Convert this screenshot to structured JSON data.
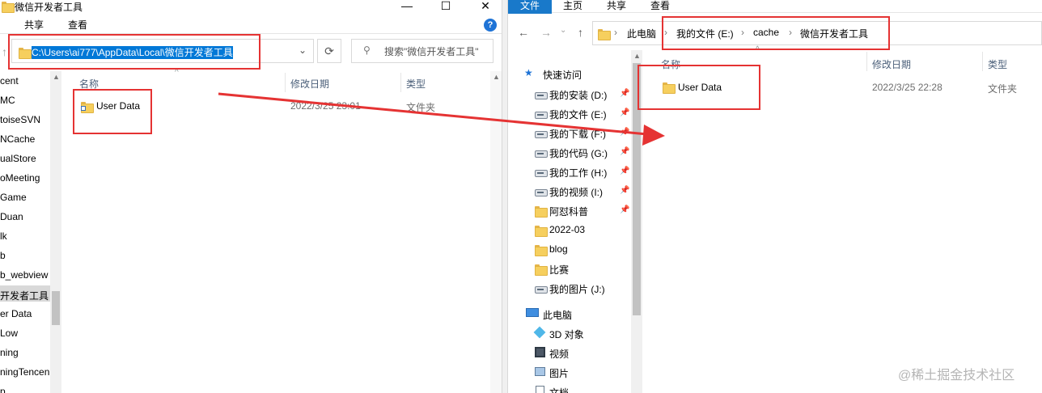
{
  "left_window": {
    "title": "微信开发者工具",
    "caption_min": "—",
    "caption_max": "☐",
    "caption_close": "✕",
    "ribbon_tabs": [
      "共享",
      "查看"
    ],
    "help": "?",
    "address_path": "C:\\Users\\ai777\\AppData\\Local\\微信开发者工具",
    "search_placeholder": "搜索\"微信开发者工具\"",
    "columns": {
      "name": "名称",
      "date": "修改日期",
      "type": "类型"
    },
    "file": {
      "name": "User Data",
      "date": "2022/3/25 23:01",
      "type": "文件夹"
    },
    "sidebar_items": [
      "cent",
      "MC",
      "toiseSVN",
      "NCache",
      "ualStore",
      "oMeeting",
      "Game",
      "Duan",
      "lk",
      "b",
      "b_webview",
      "开发者工具",
      "er Data",
      "Low",
      "ning",
      "ningTencen",
      "p"
    ]
  },
  "right_window": {
    "ribbon_tabs": [
      "文件",
      "主页",
      "共享",
      "查看"
    ],
    "breadcrumb": [
      "此电脑",
      "我的文件 (E:)",
      "cache",
      "微信开发者工具"
    ],
    "columns": {
      "name": "名称",
      "date": "修改日期",
      "type": "类型"
    },
    "file": {
      "name": "User Data",
      "date": "2022/3/25 22:28",
      "type": "文件夹"
    },
    "quick_access": "快速访问",
    "nav_items": [
      {
        "label": "我的安装 (D:)",
        "icon": "drive-icon",
        "pinned": true
      },
      {
        "label": "我的文件 (E:)",
        "icon": "drive-icon",
        "pinned": true
      },
      {
        "label": "我的下载 (F:)",
        "icon": "drive-icon",
        "pinned": true
      },
      {
        "label": "我的代码 (G:)",
        "icon": "drive-icon",
        "pinned": true
      },
      {
        "label": "我的工作 (H:)",
        "icon": "drive-icon",
        "pinned": true
      },
      {
        "label": "我的视频 (I:)",
        "icon": "drive-icon",
        "pinned": true
      },
      {
        "label": "阿怼科普",
        "icon": "folder-icon",
        "pinned": true
      },
      {
        "label": "2022-03",
        "icon": "folder-icon",
        "pinned": false
      },
      {
        "label": "blog",
        "icon": "folder-icon",
        "pinned": false
      },
      {
        "label": "比赛",
        "icon": "folder-icon",
        "pinned": false
      },
      {
        "label": "我的图片 (J:)",
        "icon": "drive-icon",
        "pinned": false
      }
    ],
    "this_pc": "此电脑",
    "pc_items": [
      {
        "label": "3D 对象",
        "icon": "3d-objects-icon"
      },
      {
        "label": "视频",
        "icon": "video-icon"
      },
      {
        "label": "图片",
        "icon": "pictures-icon"
      },
      {
        "label": "文档",
        "icon": "documents-icon"
      }
    ]
  },
  "watermark": "@稀土掘金技术社区",
  "colors": {
    "annotation_red": "#e53333",
    "accent_blue": "#0078d7",
    "folder_yellow": "#f6cf5e"
  }
}
